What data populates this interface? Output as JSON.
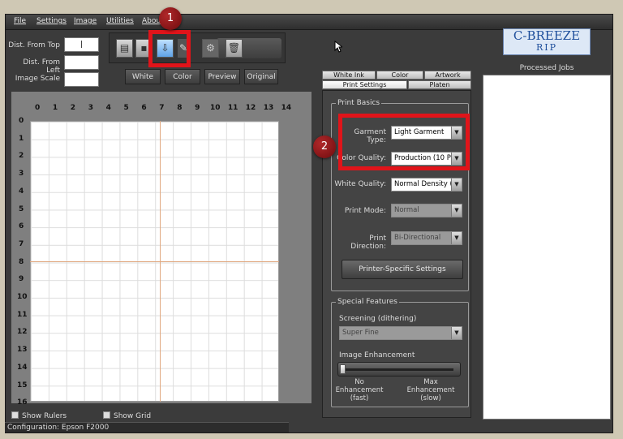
{
  "menu": [
    "File",
    "Settings",
    "Image",
    "Utilities",
    "About"
  ],
  "left_fields": {
    "dist_top_label": "Dist. From Top",
    "dist_left_label": "Dist. From Left",
    "scale_label": "Image Scale",
    "dist_top_value": "|",
    "dist_left_value": "",
    "scale_value": ""
  },
  "toolbar_icons": [
    "open-icon",
    "save-icon",
    "print-icon",
    "edit-icon",
    "gear-icon",
    "trash-icon"
  ],
  "view_buttons": [
    "White",
    "Color",
    "Preview",
    "Original"
  ],
  "ruler": {
    "x_ticks": [
      "0",
      "1",
      "2",
      "3",
      "4",
      "5",
      "6",
      "7",
      "8",
      "9",
      "10",
      "11",
      "12",
      "13",
      "14"
    ],
    "y_ticks": [
      "0",
      "1",
      "2",
      "3",
      "4",
      "5",
      "6",
      "7",
      "8",
      "9",
      "10",
      "11",
      "12",
      "13",
      "14",
      "15",
      "16"
    ]
  },
  "checkboxes": {
    "show_rulers": "Show Rulers",
    "show_grid": "Show Grid"
  },
  "status": "Configuration: Epson F2000",
  "tabs": {
    "row1": [
      "White Ink",
      "Color",
      "Artwork"
    ],
    "row2": [
      "Print Settings",
      "Platen"
    ]
  },
  "print_basics": {
    "title": "Print Basics",
    "garment_type_label": "Garment Type:",
    "garment_type_value": "Light Garment",
    "color_quality_label": "Color Quality:",
    "color_quality_value": "Production (10 Pa",
    "white_quality_label": "White Quality:",
    "white_quality_value": "Normal Density (8",
    "print_mode_label": "Print Mode:",
    "print_mode_value": "Normal",
    "print_direction_label": "Print Direction:",
    "print_direction_value": "Bi-Directional",
    "printer_specific_button": "Printer-Specific Settings"
  },
  "special_features": {
    "title": "Special Features",
    "screening_label": "Screening (dithering)",
    "screening_value": "Super Fine",
    "enhancement_label": "Image Enhancement",
    "enhancement_level": 0,
    "min_caption": "No\nEnhancement\n(fast)",
    "max_caption": "Max\nEnhancement\n(slow)"
  },
  "processed_jobs_label": "Processed Jobs",
  "logo": {
    "line1": "C-BREEZE",
    "line2": "RIP"
  },
  "callouts": [
    "1",
    "2"
  ],
  "colors": {
    "callout_red": "#e0141a",
    "badge_red": "#8b1416"
  }
}
